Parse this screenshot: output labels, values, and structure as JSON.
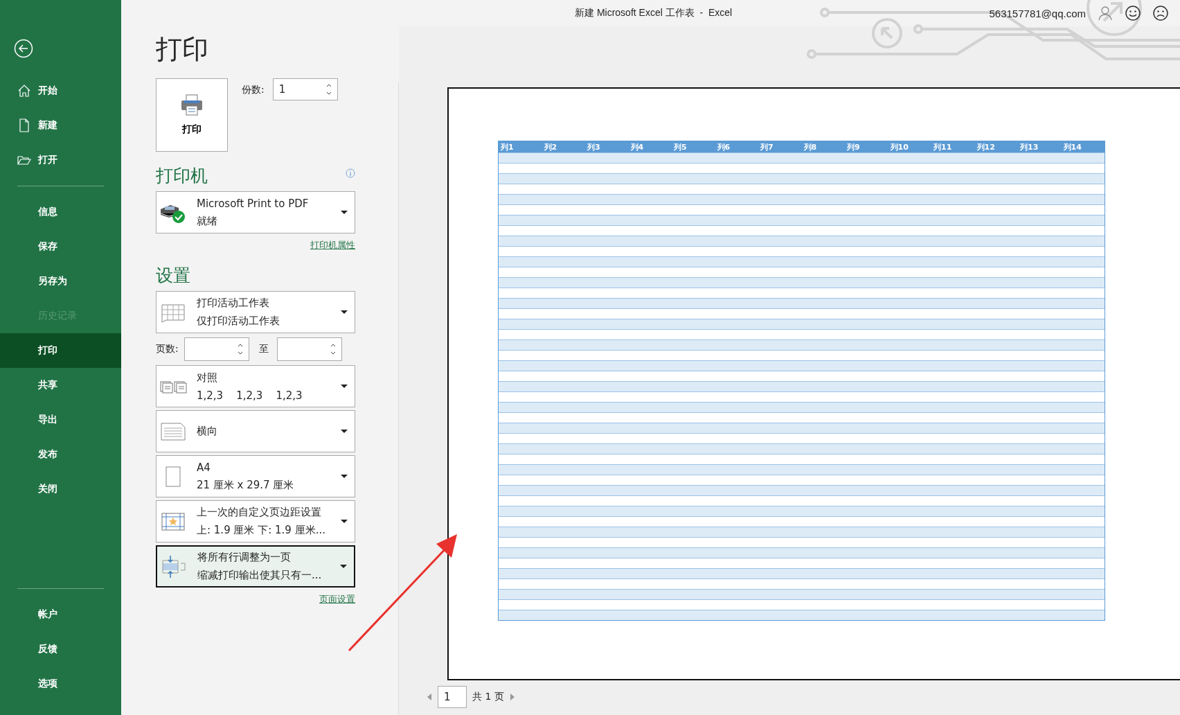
{
  "window": {
    "title": "新建 Microsoft Excel 工作表  -  Excel",
    "account": "563157781@qq.com"
  },
  "sidebar": {
    "top_items": [
      {
        "label": "开始",
        "selected": false,
        "disabled": false
      },
      {
        "label": "新建",
        "selected": false,
        "disabled": false
      },
      {
        "label": "打开",
        "selected": false,
        "disabled": false
      }
    ],
    "main_items": [
      {
        "label": "信息",
        "selected": false,
        "disabled": false
      },
      {
        "label": "保存",
        "selected": false,
        "disabled": false
      },
      {
        "label": "另存为",
        "selected": false,
        "disabled": false
      },
      {
        "label": "历史记录",
        "selected": false,
        "disabled": true
      },
      {
        "label": "打印",
        "selected": true,
        "disabled": false
      },
      {
        "label": "共享",
        "selected": false,
        "disabled": false
      },
      {
        "label": "导出",
        "selected": false,
        "disabled": false
      },
      {
        "label": "发布",
        "selected": false,
        "disabled": false
      },
      {
        "label": "关闭",
        "selected": false,
        "disabled": false
      }
    ],
    "bottom_items": [
      {
        "label": "帐户",
        "selected": false,
        "disabled": false
      },
      {
        "label": "反馈",
        "selected": false,
        "disabled": false
      },
      {
        "label": "选项",
        "selected": false,
        "disabled": false
      }
    ]
  },
  "print_panel": {
    "title": "打印",
    "print_button": "打印",
    "copies_label": "份数:",
    "copies_value": "1",
    "printer_heading": "打印机",
    "printer": {
      "name": "Microsoft Print to PDF",
      "status": "就绪"
    },
    "printer_link": "打印机属性",
    "settings_heading": "设置",
    "settings": [
      {
        "line1": "打印活动工作表",
        "line2": "仅打印活动工作表",
        "selected": false
      },
      {
        "kind": "pages",
        "label": "页数:",
        "to_label": "至"
      },
      {
        "line1": "对照",
        "line2": "1,2,3    1,2,3    1,2,3",
        "selected": false
      },
      {
        "line1": "横向",
        "selected": false
      },
      {
        "line1": "A4",
        "line2": "21 厘米 x 29.7 厘米",
        "selected": false
      },
      {
        "line1": "上一次的自定义页边距设置",
        "line2": "上: 1.9 厘米 下: 1.9 厘米...",
        "selected": false
      },
      {
        "line1": "将所有行调整为一页",
        "line2": "缩减打印输出使其只有一...",
        "selected": true
      }
    ],
    "page_setup_link": "页面设置"
  },
  "preview": {
    "columns": [
      "列1",
      "列2",
      "列3",
      "列4",
      "列5",
      "列6",
      "列7",
      "列8",
      "列9",
      "列10",
      "列11",
      "列12",
      "列13",
      "列14"
    ],
    "current_page": "1",
    "total_pages": "共 1 页"
  }
}
